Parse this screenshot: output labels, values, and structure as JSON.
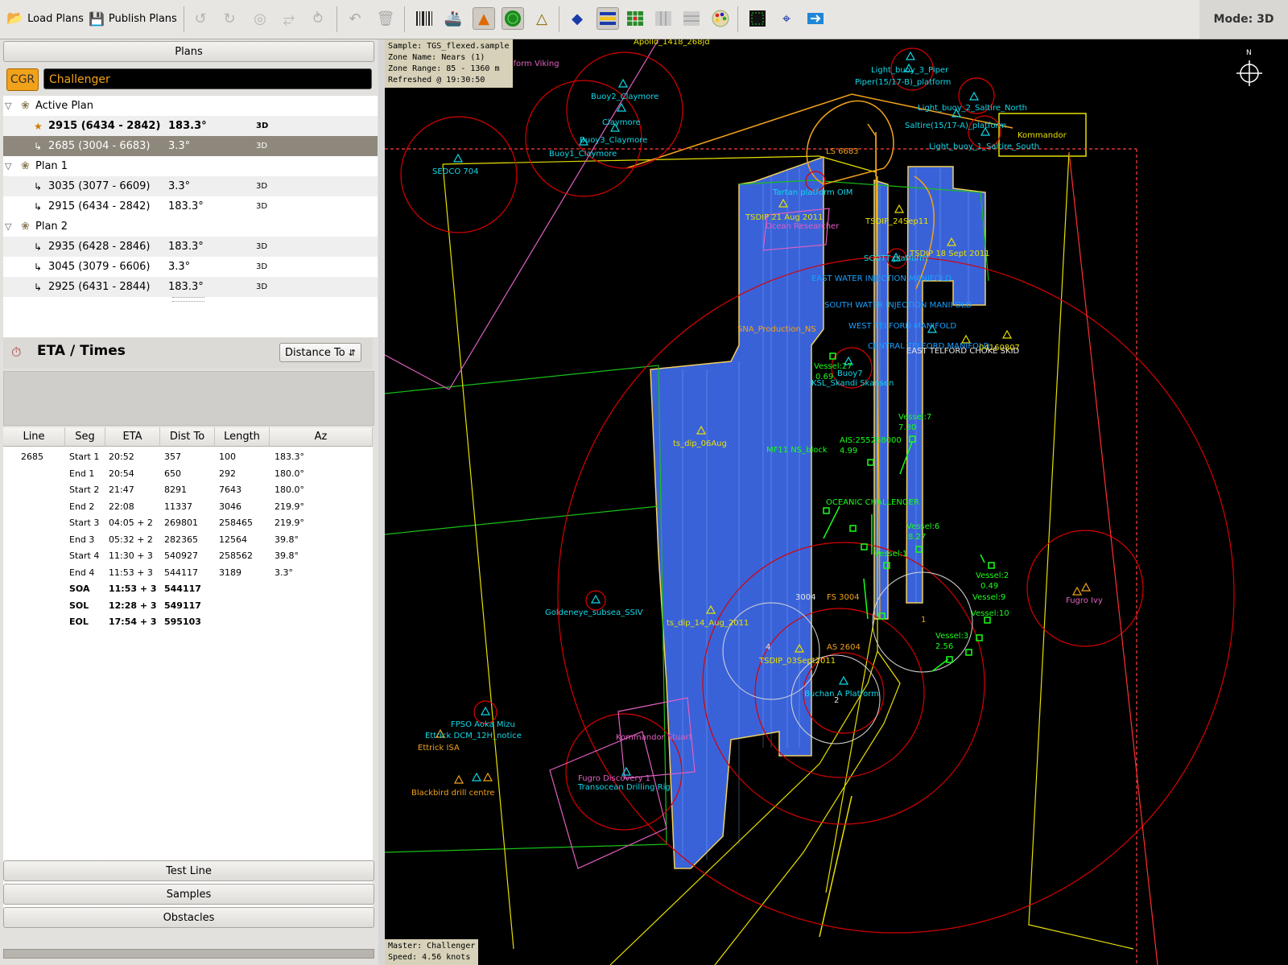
{
  "toolbar": {
    "load_label": "Load Plans",
    "publish_label": "Publish Plans",
    "mode_label": "Mode: 3D"
  },
  "plans_header": "Plans",
  "cgr_label": "CGR",
  "vessel_name": "Challenger",
  "tree": {
    "active_plan": "Active Plan",
    "plan1": "Plan 1",
    "plan2": "Plan 2",
    "rows": [
      {
        "name": "2915 (6434 - 2842)",
        "az": "183.3°",
        "tag": "3D"
      },
      {
        "name": "2685 (3004 - 6683)",
        "az": "3.3°",
        "tag": "3D"
      },
      {
        "name": "3035 (3077 - 6609)",
        "az": "3.3°",
        "tag": "3D"
      },
      {
        "name": "2915 (6434 - 2842)",
        "az": "183.3°",
        "tag": "3D"
      },
      {
        "name": "2935 (6428 - 2846)",
        "az": "183.3°",
        "tag": "3D"
      },
      {
        "name": "3045 (3079 - 6606)",
        "az": "3.3°",
        "tag": "3D"
      },
      {
        "name": "2925 (6431 - 2844)",
        "az": "183.3°",
        "tag": "3D"
      }
    ]
  },
  "eta": {
    "title": "ETA / Times",
    "dropdown": "Distance To",
    "columns": [
      "Line",
      "Seg",
      "ETA",
      "Dist To",
      "Length",
      "Az"
    ],
    "rows": [
      {
        "line": "2685",
        "seg": "Start 1",
        "eta": "20:52",
        "dist": "357",
        "len": "100",
        "az": "183.3°"
      },
      {
        "line": "",
        "seg": "End 1",
        "eta": "20:54",
        "dist": "650",
        "len": "292",
        "az": "180.0°"
      },
      {
        "line": "",
        "seg": "Start 2",
        "eta": "21:47",
        "dist": "8291",
        "len": "7643",
        "az": "180.0°"
      },
      {
        "line": "",
        "seg": "End 2",
        "eta": "22:08",
        "dist": "11337",
        "len": "3046",
        "az": "219.9°"
      },
      {
        "line": "",
        "seg": "Start 3",
        "eta": "04:05 + 2",
        "dist": "269801",
        "len": "258465",
        "az": "219.9°"
      },
      {
        "line": "",
        "seg": "End 3",
        "eta": "05:32 + 2",
        "dist": "282365",
        "len": "12564",
        "az": "39.8°"
      },
      {
        "line": "",
        "seg": "Start 4",
        "eta": "11:30 + 3",
        "dist": "540927",
        "len": "258562",
        "az": "39.8°"
      },
      {
        "line": "",
        "seg": "End 4",
        "eta": "11:53 + 3",
        "dist": "544117",
        "len": "3189",
        "az": "3.3°"
      }
    ],
    "summary": [
      {
        "seg": "SOA",
        "eta": "11:53 + 3",
        "dist": "544117"
      },
      {
        "seg": "SOL",
        "eta": "12:28 + 3",
        "dist": "549117"
      },
      {
        "seg": "EOL",
        "eta": "17:54 + 3",
        "dist": "595103"
      }
    ]
  },
  "bottom_buttons": {
    "test_line": "Test Line",
    "samples": "Samples",
    "obstacles": "Obstacles"
  },
  "map": {
    "info_lines": [
      "Sample: TGS_flexed.sample",
      "Zone Name: Nears (1)",
      "Zone Range: 85 - 1360 m",
      "Refreshed @ 19:30:50"
    ],
    "master_lines": [
      "Master: Challenger",
      "Speed: 4.56 knots"
    ],
    "compass_label": "N",
    "labels": {
      "apollo": "Apollo_1418_268jd",
      "pamform": "Pamform Viking",
      "buoy2": "Buoy2_Claymore",
      "claymore": "Claymore",
      "buoy3": "Buoy3_Claymore",
      "buoy1": "Buoy1_Claymore",
      "sedco": "SEDCO 704",
      "light3": "Light_buoy_3_Piper",
      "piper": "Piper(15/17-B)_platform",
      "light2": "Light_buoy_2_Saltire_North",
      "saltire": "Saltire(15/17-A)_platform",
      "kommandor": "Kommandor",
      "light1": "Light_buoy_1_Saltire_South",
      "ls": "LS 6683",
      "oim": "Tartan platform OIM",
      "tsdip21": "TSDIP 21 Aug 2011",
      "ocean": "Ocean Researcher",
      "tsdip24": "TSDIP_24Sep11",
      "tsdip18": "TSDIP 18 Sept 2011",
      "scott": "SCOTT platform",
      "east_water": "EAST WATER INJECTION MANIFOLD",
      "south_water": "SOUTH WATER INJECTION MANIFOLD",
      "west_telford": "WEST TELFORD MANIFOLD",
      "central_telford": "CENTRAL TELFORD MANIFOLD",
      "east_telford": "EAST TELFORD CHOKE SKID",
      "sna": "SNA_Production_NS",
      "code": "04160807",
      "buoy7": "Buoy7",
      "skandi": "KSL_Skandi Skansen",
      "vessel27": "Vessel:27",
      "v069": "0.69",
      "vessel7": "Vessel:7",
      "v730": "7.30",
      "tsdip06": "ts_dip_06Aug",
      "mf11": "MF11 NS_block",
      "ais": "AIS:255268000",
      "v499": "4.99",
      "oceanic": "OCEANIC CHALLENGER",
      "vessel6": "Vessel:6",
      "v827": "8.27",
      "vessel1": "Vessel:1",
      "vessel2": "Vessel:2",
      "v049": "0.49",
      "vessel9": "Vessel:9",
      "vessel10": "Vessel:10",
      "vessel3": "Vessel:3",
      "v256": "2.56",
      "ivy": "Fugro Ivy",
      "fs": "FS 3004",
      "n3004": "3004",
      "as": "AS 2604",
      "tsdip03": "TSDIP_03Sept2011",
      "buchan": "Buchan A Platform",
      "tsdip14": "ts_dip_14_Aug_2011",
      "goldeneye": "Goldeneye_subsea_SSIV",
      "fpso": "FPSO Aoka Mizu",
      "ettrick_dcm": "Ettrick DCM_12H_notice",
      "ettrick_isa": "Ettrick ISA",
      "blackbird": "Blackbird drill centre",
      "kommandor_stuart": "Kommandor Stuart",
      "fugro_discovery": "Fugro Discovery 1",
      "transocean": "Transocean Drilling Rig",
      "n1": "1",
      "n2": "2",
      "n4": "4"
    }
  },
  "colors": {
    "survey_fill": "#3a62d8",
    "accent_orange": "#f2a21a",
    "zone_red": "#d80000",
    "green": "#18c018"
  }
}
